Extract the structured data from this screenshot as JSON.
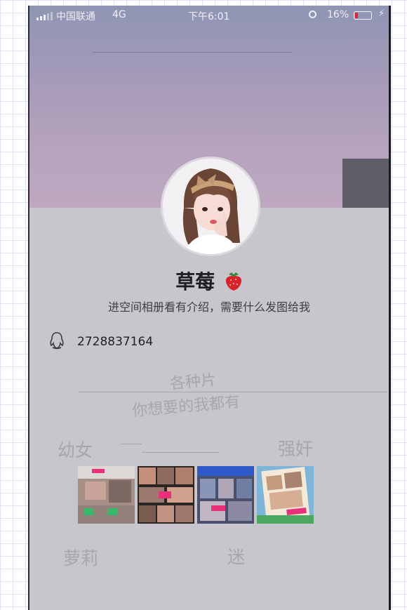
{
  "status_bar": {
    "carrier": "中国联通",
    "network": "4G",
    "time": "下午6:01",
    "battery": "16%",
    "battery_level": 0.16
  },
  "profile": {
    "name": "草莓",
    "bio": "进空间相册看有介绍，需要什么发图给我",
    "qq_number": "2728837164"
  },
  "overlay_texts": {
    "line1": "各种片",
    "line2": "你想要的我都有",
    "word1": "幼女",
    "word2": "强奸",
    "word3": "萝莉",
    "word4": "迷"
  },
  "icons": {
    "qq": "qq-penguin-icon",
    "strawberry": "strawberry-emoji",
    "signal": "signal-bars-icon",
    "orientation_lock": "orientation-lock-icon",
    "battery": "battery-icon",
    "charging": "charging-bolt-icon"
  },
  "colors": {
    "battery_low": "#e0242f",
    "cover_top": "#8f95b4",
    "cover_bottom": "#bea8c0"
  }
}
